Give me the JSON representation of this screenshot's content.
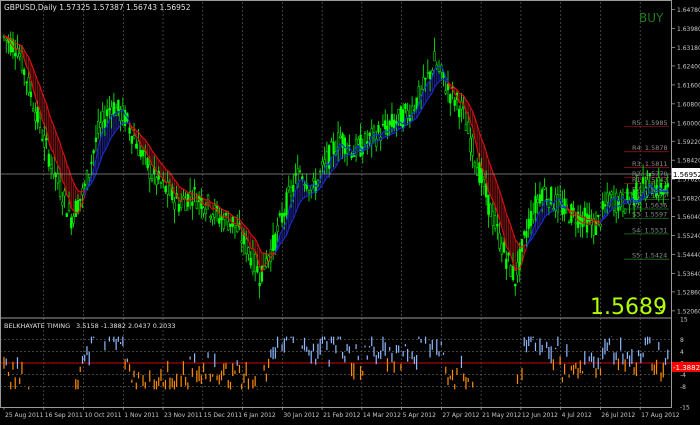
{
  "chart_data": [
    {
      "type": "candlestick",
      "symbol_line": "GBPUSD,Daily  1.57325 1.57387 1.56743 1.56952",
      "signal": "BUY",
      "big_price": "1.5689",
      "big_price_suffix": "9",
      "current_price_tag": "1.56952",
      "yticks": [
        "1.64780",
        "1.63980",
        "1.63180",
        "1.62400",
        "1.61600",
        "1.60800",
        "1.60000",
        "1.59220",
        "1.58420",
        "1.57620",
        "1.56820",
        "1.56040",
        "1.55240",
        "1.54440",
        "1.53640",
        "1.52860",
        "1.52060"
      ],
      "ylim": [
        1.518,
        1.651
      ],
      "xticks": [
        "25 Aug 2011",
        "16 Sep 2011",
        "10 Oct 2011",
        "1 Nov 2011",
        "23 Nov 2011",
        "15 Dec 2011",
        "6 Jan 2012",
        "30 Jan 2012",
        "21 Feb 2012",
        "14 Mar 2012",
        "5 Apr 2012",
        "27 Apr 2012",
        "21 May 2012",
        "12 Jun 2012",
        "4 Jul 2012",
        "26 Jul 2012",
        "17 Aug 2012"
      ],
      "pivot_levels": [
        {
          "label": "R5: 1.5985",
          "value": 1.5985
        },
        {
          "label": "R4: 1.5878",
          "value": 1.5878
        },
        {
          "label": "R3: 1.5811",
          "value": 1.5811
        },
        {
          "label": "R2: 1.5770",
          "value": 1.577
        },
        {
          "label": "R1: 1.5743",
          "value": 1.5743
        },
        {
          "label": "PV: 1.5704",
          "value": 1.5704
        },
        {
          "label": "S1: 1.5677",
          "value": 1.5677
        },
        {
          "label": "S2: 1.5636",
          "value": 1.5636
        },
        {
          "label": "S3: 1.5597",
          "value": 1.5597
        },
        {
          "label": "S4: 1.5531",
          "value": 1.5531
        },
        {
          "label": "S5: 1.5424",
          "value": 1.5424
        }
      ],
      "price_path": [
        [
          0,
          1.636
        ],
        [
          6,
          1.632
        ],
        [
          12,
          1.612
        ],
        [
          18,
          1.592
        ],
        [
          24,
          1.575
        ],
        [
          30,
          1.56
        ],
        [
          36,
          1.572
        ],
        [
          42,
          1.596
        ],
        [
          48,
          1.608
        ],
        [
          54,
          1.602
        ],
        [
          60,
          1.59
        ],
        [
          66,
          1.578
        ],
        [
          72,
          1.572
        ],
        [
          78,
          1.566
        ],
        [
          84,
          1.57
        ],
        [
          90,
          1.566
        ],
        [
          96,
          1.56
        ],
        [
          102,
          1.558
        ],
        [
          108,
          1.548
        ],
        [
          114,
          1.536
        ],
        [
          120,
          1.548
        ],
        [
          126,
          1.566
        ],
        [
          132,
          1.58
        ],
        [
          138,
          1.572
        ],
        [
          144,
          1.584
        ],
        [
          150,
          1.594
        ],
        [
          156,
          1.588
        ],
        [
          162,
          1.592
        ],
        [
          168,
          1.596
        ],
        [
          174,
          1.6
        ],
        [
          180,
          1.604
        ],
        [
          186,
          1.612
        ],
        [
          192,
          1.626
        ],
        [
          198,
          1.614
        ],
        [
          204,
          1.606
        ],
        [
          210,
          1.586
        ],
        [
          216,
          1.566
        ],
        [
          222,
          1.548
        ],
        [
          228,
          1.534
        ],
        [
          234,
          1.558
        ],
        [
          240,
          1.572
        ],
        [
          246,
          1.566
        ],
        [
          252,
          1.562
        ],
        [
          258,
          1.56
        ],
        [
          264,
          1.556
        ],
        [
          270,
          1.568
        ],
        [
          276,
          1.566
        ],
        [
          282,
          1.57
        ],
        [
          288,
          1.574
        ],
        [
          296,
          1.571
        ]
      ],
      "n_bars": 297,
      "colors": {
        "bull": "#00ff00",
        "bear": "#00ff00",
        "ma_up": "#1c2bd6",
        "ma_down": "#e01010",
        "fill_up": "#1a1f7a",
        "fill_down": "#7a1010",
        "grid": "#6a6a6a",
        "axis_text": "#c8c8c8",
        "pivot_text": "#8a8a8a",
        "pivot_line_r": "#8a1010",
        "pivot_line_s": "#1f7a1f",
        "signal": "#1e7a1e",
        "big_price": "#b0ff00"
      }
    },
    {
      "type": "bar",
      "title": "BELKHAYATE TIMING",
      "values_line": "3.5158 -1.3882 2.0437 0.2033",
      "yticks": [
        "15",
        "8",
        "4",
        "0",
        "-4",
        "-8",
        "-15"
      ],
      "ylim": [
        -15,
        15
      ],
      "current_value_tag": "-1.3882",
      "n_bars": 297,
      "colors": {
        "pos": "#8fb8ff",
        "neg": "#ff8c00",
        "level": "#6a6a6a",
        "tag_bg": "#ff0000"
      }
    }
  ]
}
